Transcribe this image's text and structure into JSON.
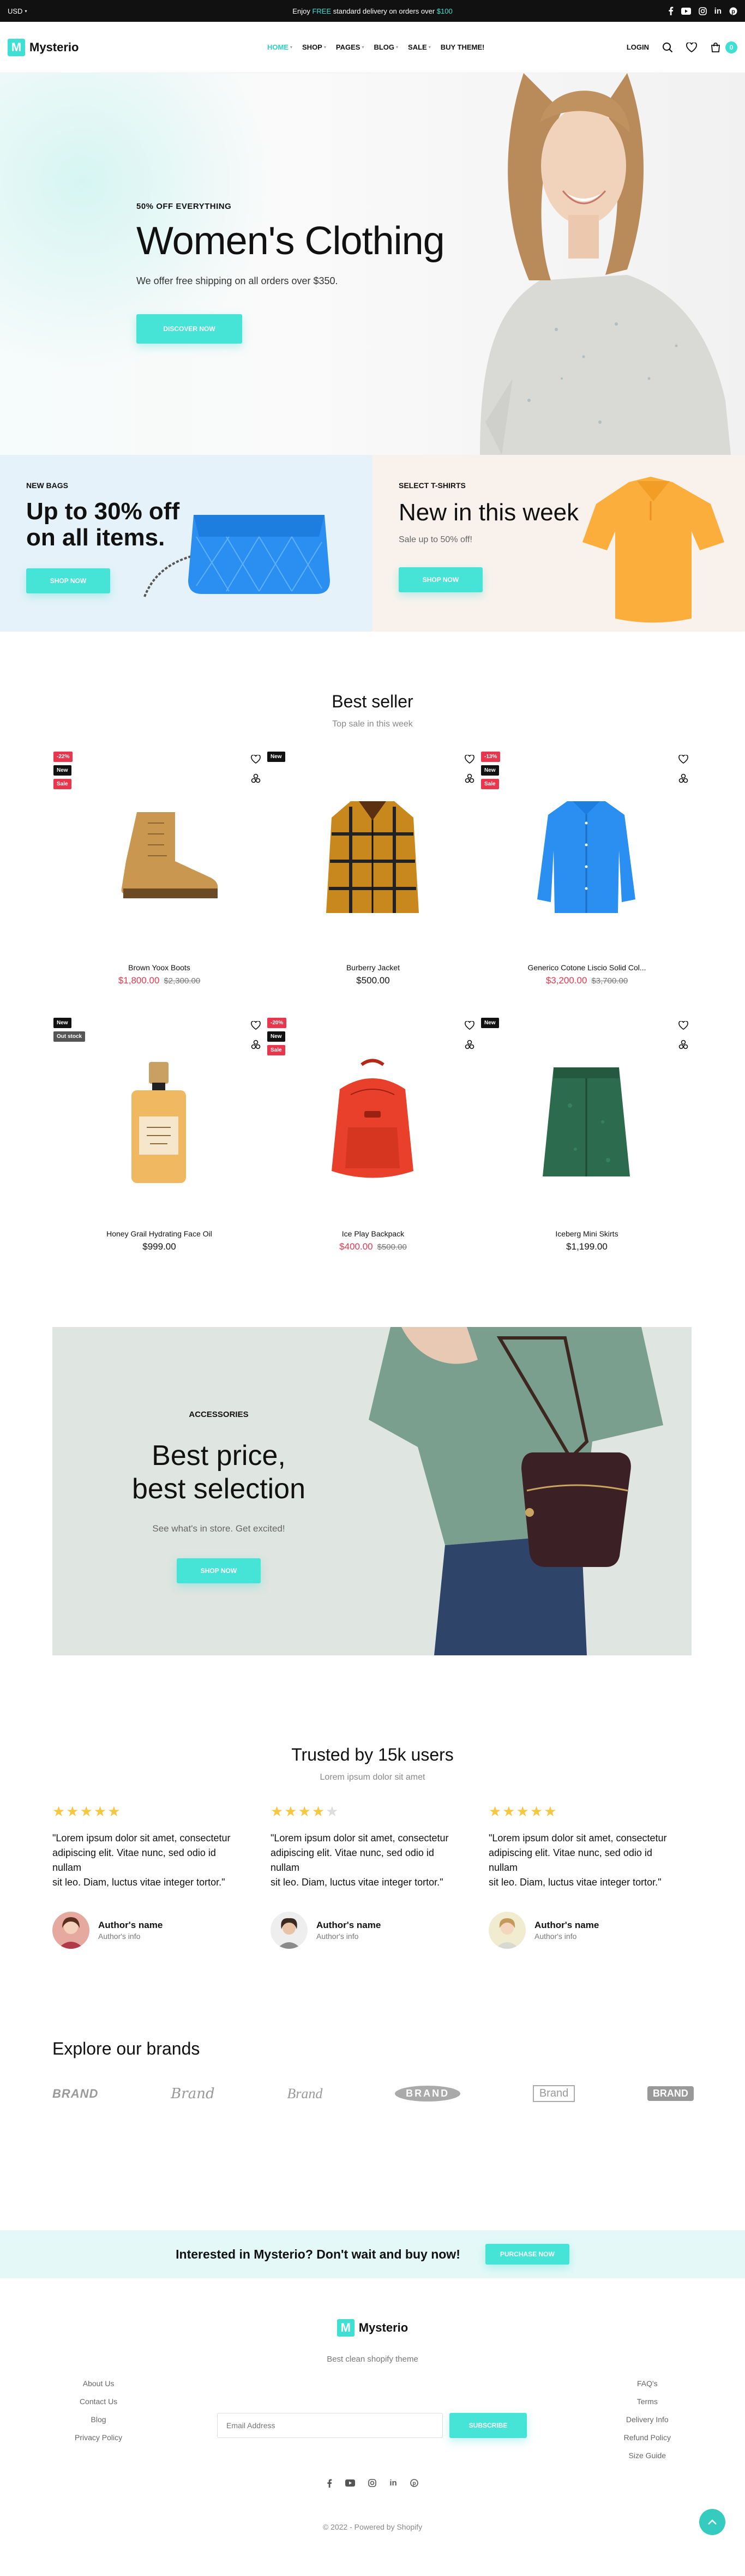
{
  "topbar": {
    "currency": "USD",
    "promo_before": "Enjoy ",
    "promo_highlight": "FREE",
    "promo_middle": " standard delivery on orders over ",
    "promo_amount": "$100"
  },
  "header": {
    "brand": "Mysterio",
    "logo_letter": "M",
    "nav": [
      {
        "label": "HOME"
      },
      {
        "label": "SHOP"
      },
      {
        "label": "PAGES"
      },
      {
        "label": "BLOG"
      },
      {
        "label": "SALE"
      },
      {
        "label": "BUY THEME!"
      }
    ],
    "login": "LOGIN",
    "cart_count": "0"
  },
  "hero": {
    "subtitle": "50% OFF EVERYTHING",
    "title": "Women's Clothing",
    "description": "We offer free shipping on all orders over $350.",
    "button": "DISCOVER NOW"
  },
  "banners": [
    {
      "label": "NEW BAGS",
      "title_line1": "Up to 30% off",
      "title_line2": "on all items.",
      "button": "SHOP NOW"
    },
    {
      "label": "SELECT T-SHIRTS",
      "title": "New in this week",
      "subtitle": "Sale up to 50% off!",
      "button": "SHOP NOW"
    }
  ],
  "bestseller": {
    "title": "Best seller",
    "subtitle": "Top sale in this week",
    "products": [
      {
        "name": "Brown Yoox Boots",
        "price": "$1,800.00",
        "old_price": "$2,300.00",
        "badges": [
          "-22%",
          "New",
          "Sale"
        ]
      },
      {
        "name": "Burberry Jacket",
        "price": "$500.00",
        "old_price": "",
        "badges": [
          "New"
        ]
      },
      {
        "name": "Generico Cotone Liscio Solid Col...",
        "price": "$3,200.00",
        "old_price": "$3,700.00",
        "badges": [
          "-13%",
          "New",
          "Sale"
        ]
      },
      {
        "name": "Honey Grail Hydrating Face Oil",
        "price": "$999.00",
        "old_price": "",
        "badges": [
          "New",
          "Out stock"
        ]
      },
      {
        "name": "Ice Play Backpack",
        "price": "$400.00",
        "old_price": "$500.00",
        "badges": [
          "-20%",
          "New",
          "Sale"
        ]
      },
      {
        "name": "Iceberg Mini Skirts",
        "price": "$1,199.00",
        "old_price": "",
        "badges": [
          "New"
        ]
      }
    ]
  },
  "promo": {
    "label": "ACCESSORIES",
    "title_line1": "Best price,",
    "title_line2": "best selection",
    "description": "See what's in store. Get excited!",
    "button": "SHOP NOW"
  },
  "testimonials": {
    "title": "Trusted by 15k users",
    "subtitle": "Lorem ipsum dolor sit amet",
    "items": [
      {
        "stars": 5,
        "line1": "\"Lorem ipsum dolor sit amet, consectetur",
        "line2": "adipiscing elit. Vitae nunc, sed odio id",
        "line3": "nullam",
        "line4": "sit leo. Diam, luctus vitae integer tortor.\"",
        "author": "Author's name",
        "info": "Author's info"
      },
      {
        "stars": 4,
        "line1": "\"Lorem ipsum dolor sit amet, consectetur",
        "line2": "adipiscing elit. Vitae nunc, sed odio id",
        "line3": "nullam",
        "line4": "sit leo. Diam, luctus vitae integer tortor.\"",
        "author": "Author's name",
        "info": "Author's info"
      },
      {
        "stars": 5,
        "line1": "\"Lorem ipsum dolor sit amet, consectetur",
        "line2": "adipiscing elit. Vitae nunc, sed odio id",
        "line3": "nullam",
        "line4": "sit leo. Diam, luctus vitae integer tortor.\"",
        "author": "Author's name",
        "info": "Author's info"
      }
    ]
  },
  "brands": {
    "title": "Explore our brands",
    "items": [
      "BRAND",
      "Brand",
      "Brand",
      "BRAND",
      "Brand",
      "BRAND"
    ]
  },
  "cta": {
    "text": "Interested in Mysterio? Don't wait and buy now!",
    "button": "PURCHASE NOW"
  },
  "footer": {
    "brand": "Mysterio",
    "tagline": "Best clean shopify theme",
    "left_links": [
      "About Us",
      "Contact Us",
      "Blog",
      "Privacy Policy"
    ],
    "right_links": [
      "FAQ's",
      "Terms",
      "Delivery Info",
      "Refund Policy",
      "Size Guide"
    ],
    "email_placeholder": "Email Address",
    "subscribe": "SUBSCRIBE",
    "copyright": "© 2022 - Powered by Shopify"
  },
  "colors": {
    "accent": "#3ee0d4",
    "sale": "#e8374d",
    "dark": "#111111"
  }
}
